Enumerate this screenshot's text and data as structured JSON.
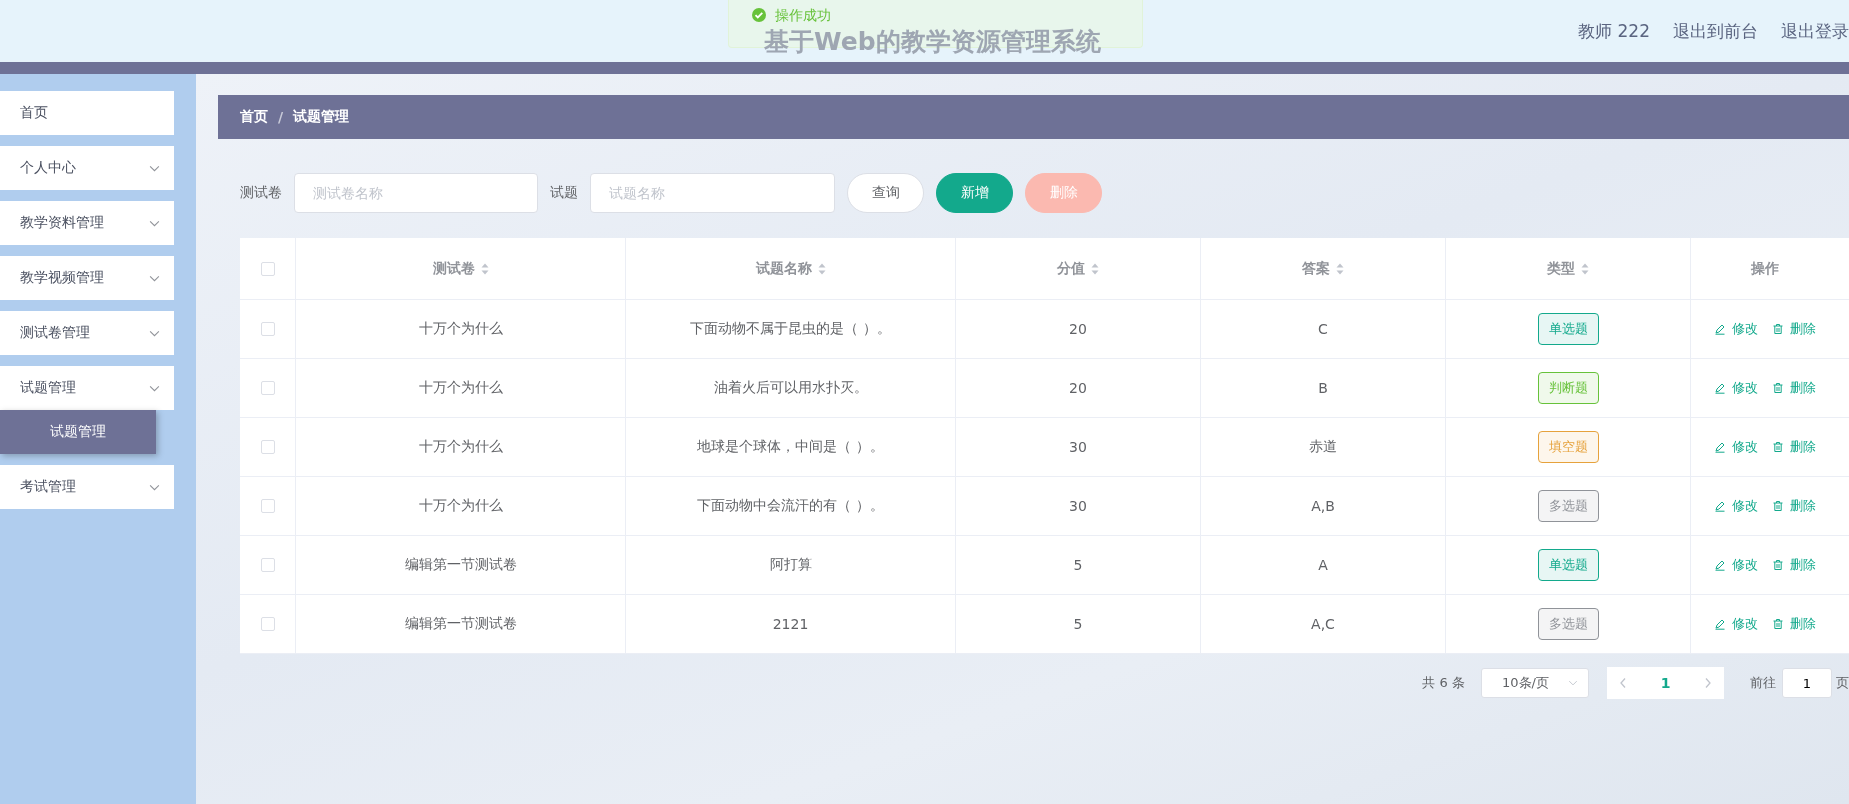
{
  "header": {
    "title": "基于Web的教学资源管理系统",
    "user": "教师 222",
    "links": [
      "退出到前台",
      "退出登录"
    ]
  },
  "toast": {
    "text": "操作成功"
  },
  "sidebar": {
    "items": [
      {
        "label": "首页",
        "has_children": false
      },
      {
        "label": "个人中心",
        "has_children": true
      },
      {
        "label": "教学资料管理",
        "has_children": true
      },
      {
        "label": "教学视频管理",
        "has_children": true
      },
      {
        "label": "测试卷管理",
        "has_children": true
      },
      {
        "label": "试题管理",
        "has_children": true,
        "children": [
          {
            "label": "试题管理",
            "selected": true
          }
        ]
      },
      {
        "label": "考试管理",
        "has_children": true
      }
    ]
  },
  "breadcrumb": {
    "items": [
      "首页",
      "试题管理"
    ],
    "separator": "/"
  },
  "search": {
    "fields": [
      {
        "label": "测试卷",
        "placeholder": "测试卷名称"
      },
      {
        "label": "试题",
        "placeholder": "试题名称"
      }
    ],
    "buttons": [
      {
        "label": "查询",
        "kind": "plain"
      },
      {
        "label": "新增",
        "kind": "primary"
      },
      {
        "label": "删除",
        "kind": "danger"
      }
    ]
  },
  "table": {
    "select_all": {
      "checked": false
    },
    "columns": [
      {
        "label": "测试卷",
        "kind": "sortable"
      },
      {
        "label": "试题名称",
        "kind": "sortable"
      },
      {
        "label": "分值",
        "kind": "sortable"
      },
      {
        "label": "答案",
        "kind": "sortable"
      },
      {
        "label": "类型",
        "kind": "sortable"
      },
      {
        "label": "操作",
        "kind": "plain"
      }
    ],
    "rows": [
      {
        "checked": false,
        "paper": "十万个为什么",
        "question": "下面动物不属于昆虫的是（ ）。",
        "score": "20",
        "answer": "C",
        "type": {
          "text": "单选题",
          "color": "#13a98c"
        },
        "actions": [
          "修改",
          "删除"
        ]
      },
      {
        "checked": false,
        "paper": "十万个为什么",
        "question": "油着火后可以用水扑灭。",
        "score": "20",
        "answer": "B",
        "type": {
          "text": "判断题",
          "color": "#67c23a"
        },
        "actions": [
          "修改",
          "删除"
        ]
      },
      {
        "checked": false,
        "paper": "十万个为什么",
        "question": "地球是个球体，中间是（ ）。",
        "score": "30",
        "answer": "赤道",
        "type": {
          "text": "填空题",
          "color": "#e6a23c"
        },
        "actions": [
          "修改",
          "删除"
        ]
      },
      {
        "checked": false,
        "paper": "十万个为什么",
        "question": "下面动物中会流汗的有（ ）。",
        "score": "30",
        "answer": "A,B",
        "type": {
          "text": "多选题",
          "color": "#909399"
        },
        "actions": [
          "修改",
          "删除"
        ]
      },
      {
        "checked": false,
        "paper": "编辑第一节测试卷",
        "question": "阿打算",
        "score": "5",
        "answer": "A",
        "type": {
          "text": "单选题",
          "color": "#13a98c"
        },
        "actions": [
          "修改",
          "删除"
        ]
      },
      {
        "checked": false,
        "paper": "编辑第一节测试卷",
        "question": "2121",
        "score": "5",
        "answer": "A,C",
        "type": {
          "text": "多选题",
          "color": "#909399"
        },
        "actions": [
          "修改",
          "删除"
        ]
      }
    ]
  },
  "pagination": {
    "total": "共 6 条",
    "page_size": "10条/页",
    "pages": [
      {
        "label": "1",
        "selected": true
      }
    ],
    "goto_label": "前往",
    "goto_value": "1",
    "goto_suffix": "页"
  }
}
